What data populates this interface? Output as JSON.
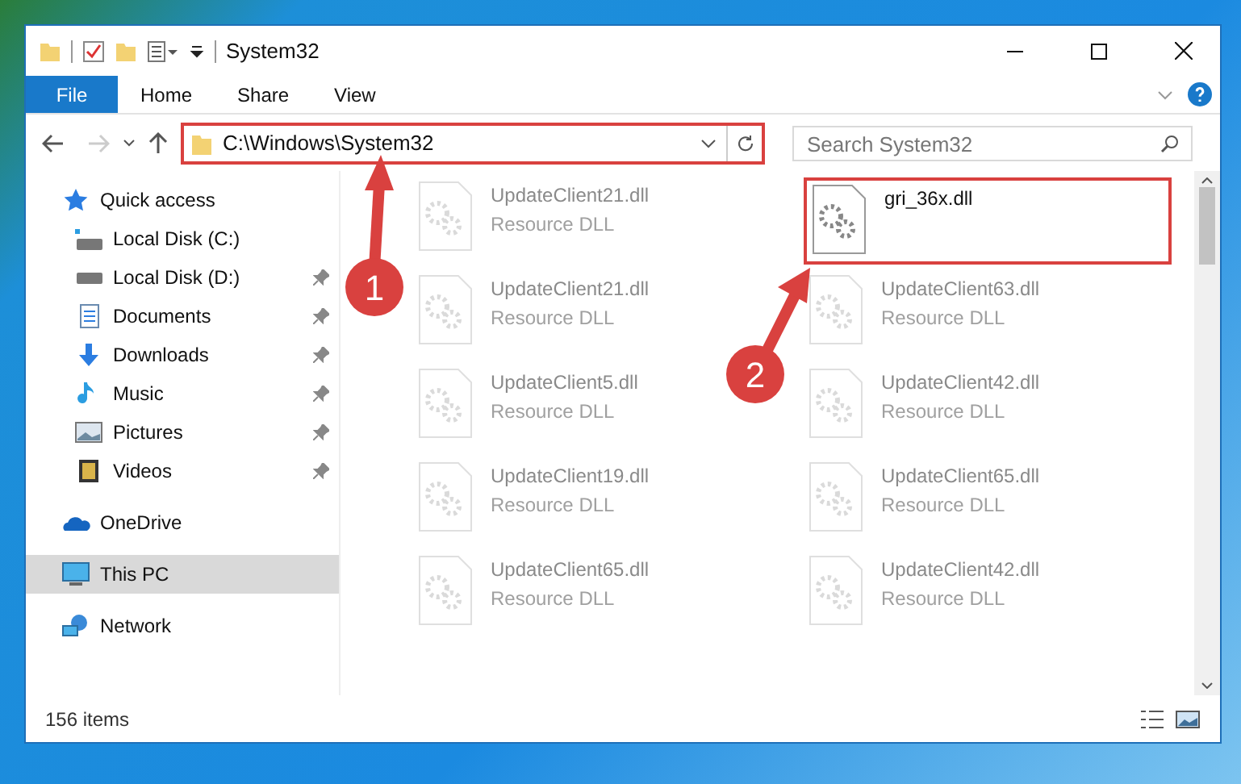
{
  "window": {
    "title": "System32"
  },
  "ribbon_tabs": [
    {
      "label": "File",
      "selected": true
    },
    {
      "label": "Home",
      "selected": false
    },
    {
      "label": "Share",
      "selected": false
    },
    {
      "label": "View",
      "selected": false
    }
  ],
  "address": {
    "value": "C:\\Windows\\System32",
    "highlighted": true
  },
  "search": {
    "placeholder": "Search System32"
  },
  "sidebar": {
    "items": [
      {
        "label": "Quick access",
        "kind": "star",
        "pinned": false,
        "selected": false,
        "children": [
          {
            "label": "Local Disk (C:)",
            "kind": "disk-c",
            "pinned": false,
            "selected": false
          },
          {
            "label": "Local Disk (D:)",
            "kind": "disk",
            "pinned": true,
            "selected": false
          },
          {
            "label": "Documents",
            "kind": "documents",
            "pinned": true,
            "selected": false
          },
          {
            "label": "Downloads",
            "kind": "downloads",
            "pinned": true,
            "selected": false
          },
          {
            "label": "Music",
            "kind": "music",
            "pinned": true,
            "selected": false
          },
          {
            "label": "Pictures",
            "kind": "pictures",
            "pinned": true,
            "selected": false
          },
          {
            "label": "Videos",
            "kind": "videos",
            "pinned": true,
            "selected": false
          }
        ]
      },
      {
        "label": "OneDrive",
        "kind": "cloud",
        "pinned": false,
        "selected": false
      },
      {
        "label": "This PC",
        "kind": "pc",
        "pinned": false,
        "selected": true
      },
      {
        "label": "Network",
        "kind": "network",
        "pinned": false,
        "selected": false
      }
    ]
  },
  "files": [
    {
      "name": "UpdateClient21.dll",
      "type": "Resource DLL",
      "faded": true,
      "highlighted": false
    },
    {
      "name": "gri_36x.dll",
      "faded": false,
      "highlighted": true
    },
    {
      "name": "UpdateClient21.dll",
      "type": "Resource DLL",
      "faded": true,
      "highlighted": false
    },
    {
      "name": "UpdateClient63.dll",
      "type": "Resource DLL",
      "faded": true,
      "highlighted": false
    },
    {
      "name": "UpdateClient5.dll",
      "type": "Resource DLL",
      "faded": true,
      "highlighted": false
    },
    {
      "name": "UpdateClient42.dll",
      "type": "Resource DLL",
      "faded": true,
      "highlighted": false
    },
    {
      "name": "UpdateClient19.dll",
      "type": "Resource DLL",
      "faded": true,
      "highlighted": false
    },
    {
      "name": "UpdateClient65.dll",
      "type": "Resource DLL",
      "faded": true,
      "highlighted": false
    },
    {
      "name": "UpdateClient65.dll",
      "type": "Resource DLL",
      "faded": true,
      "highlighted": false
    },
    {
      "name": "UpdateClient42.dll",
      "type": "Resource DLL",
      "faded": true,
      "highlighted": false
    }
  ],
  "status_bar": {
    "item_count": "156 items"
  },
  "annotations": [
    {
      "number": "1"
    },
    {
      "number": "2"
    }
  ]
}
